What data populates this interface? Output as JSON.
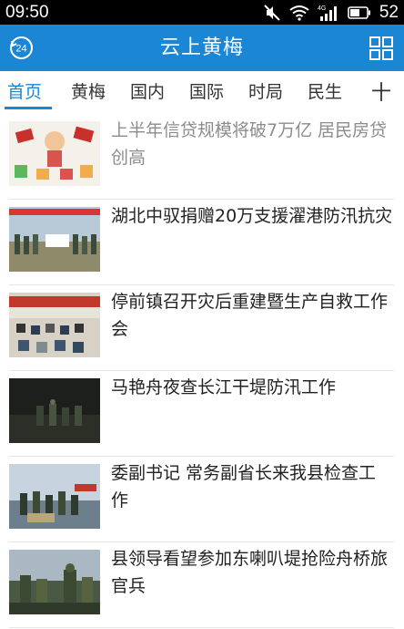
{
  "status_bar": {
    "time": "09:50",
    "battery": "52"
  },
  "app": {
    "title": "云上黄梅"
  },
  "tabs": [
    "首页",
    "黄梅",
    "国内",
    "国际",
    "时局",
    "民生"
  ],
  "tab_add": "十",
  "news": [
    {
      "title": "上半年信贷规模将破7万亿 居民房贷创高",
      "read": true
    },
    {
      "title": "湖北中驭捐赠20万支援濯港防汛抗灾",
      "read": false
    },
    {
      "title": "停前镇召开灾后重建暨生产自救工作会",
      "read": false
    },
    {
      "title": "马艳舟夜查长江干堤防汛工作",
      "read": false
    },
    {
      "title": "委副书记 常务副省长来我县检查工作",
      "read": false
    },
    {
      "title": "县领导看望参加东喇叭堤抢险舟桥旅官兵",
      "read": false
    }
  ]
}
